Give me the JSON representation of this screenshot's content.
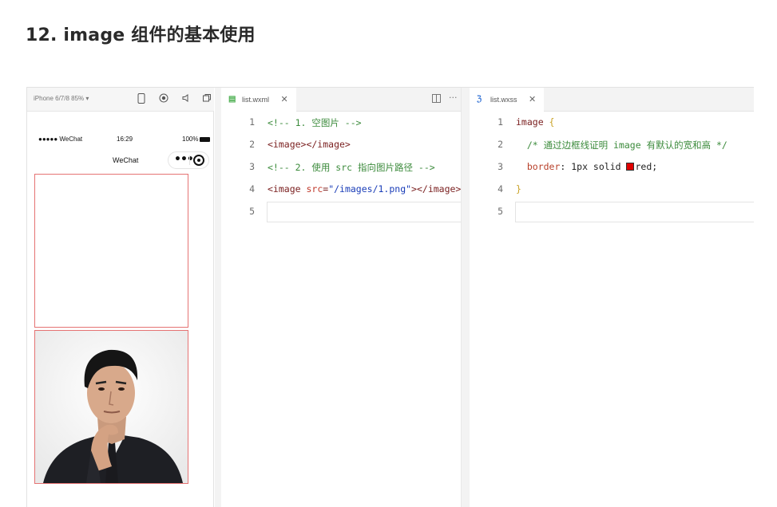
{
  "page": {
    "title": "12. image 组件的基本使用"
  },
  "simulator": {
    "device_label": "iPhone 6/7/8 85% ▾",
    "status": {
      "carrier": "●●●●● WeChat",
      "time": "16:29",
      "battery": "100%"
    },
    "nav_title": "WeChat",
    "toolbar_icons": [
      "phone-icon",
      "record-icon",
      "volume-icon",
      "window-icon",
      "split-icon"
    ]
  },
  "editor_wxml": {
    "tab_label": "list.wxml",
    "tab_close": "✕",
    "lines": [
      {
        "no": "1",
        "parts": [
          {
            "t": "<!-- 1. 空图片 -->",
            "c": "comment"
          }
        ]
      },
      {
        "no": "2",
        "parts": [
          {
            "t": "<image></image>",
            "c": "tag"
          }
        ]
      },
      {
        "no": "3",
        "parts": [
          {
            "t": "<!-- 2. 使用 src 指向图片路径 -->",
            "c": "comment"
          }
        ]
      },
      {
        "no": "4",
        "parts": [
          {
            "t": "<image ",
            "c": "tag"
          },
          {
            "t": "src",
            "c": "attr"
          },
          {
            "t": "=",
            "c": "tag"
          },
          {
            "t": "\"/images/1.png\"",
            "c": "str"
          },
          {
            "t": "></image>",
            "c": "tag"
          }
        ]
      },
      {
        "no": "5",
        "parts": []
      }
    ]
  },
  "editor_wxss": {
    "tab_label": "list.wxss",
    "tab_close": "✕",
    "lines": [
      {
        "no": "1",
        "parts": [
          {
            "t": "image ",
            "c": "sel"
          },
          {
            "t": "{",
            "c": "brace"
          }
        ]
      },
      {
        "no": "2",
        "parts": [
          {
            "t": "  /* 通过边框线证明 image 有默认的宽和高 */",
            "c": "comment"
          }
        ]
      },
      {
        "no": "3",
        "parts": [
          {
            "t": "  border",
            "c": "prop"
          },
          {
            "t": ": 1px solid ",
            "c": "val"
          },
          {
            "t": "SWATCH",
            "c": "swatch"
          },
          {
            "t": "red;",
            "c": "val"
          }
        ]
      },
      {
        "no": "4",
        "parts": [
          {
            "t": "}",
            "c": "brace"
          }
        ]
      },
      {
        "no": "5",
        "parts": []
      }
    ]
  },
  "colors": {
    "image_border": "#e57373",
    "swatch_red": "#e00000",
    "comment": "#3c8b3c"
  }
}
